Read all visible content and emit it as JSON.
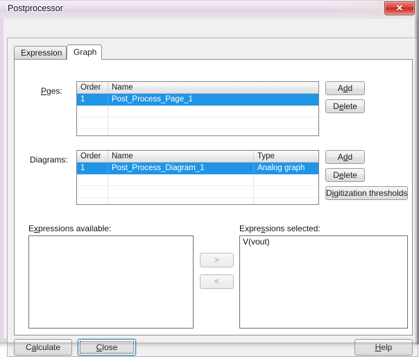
{
  "window": {
    "title": "Postprocessor",
    "close_glyph": "✕",
    "close_icon_name": "close-icon"
  },
  "tabs": [
    {
      "label": "Expression",
      "active": false
    },
    {
      "label": "Graph",
      "active": true
    }
  ],
  "pages_section": {
    "label_pre": "P",
    "label_acc": "a",
    "label_post": "ges:",
    "label_full": "Pages:",
    "columns": [
      "Order",
      "Name"
    ],
    "rows": [
      {
        "order": "1",
        "name": "Post_Process_Page_1",
        "selected": true
      },
      {
        "order": "",
        "name": "",
        "selected": false
      },
      {
        "order": "",
        "name": "",
        "selected": false
      },
      {
        "order": "",
        "name": "",
        "selected": false
      }
    ],
    "buttons": [
      {
        "pre": "A",
        "acc": "d",
        "post": "d",
        "full": "Add"
      },
      {
        "pre": "D",
        "acc": "e",
        "post": "lete",
        "full": "Delete"
      }
    ]
  },
  "diagrams_section": {
    "label_pre": "Dia",
    "label_acc": "g",
    "label_post": "rams:",
    "label_full": "Diagrams:",
    "columns": [
      "Order",
      "Name",
      "Type"
    ],
    "rows": [
      {
        "order": "1",
        "name": "Post_Process_Diagram_1",
        "type": "Analog graph",
        "selected": true
      },
      {
        "order": "",
        "name": "",
        "type": "",
        "selected": false
      },
      {
        "order": "",
        "name": "",
        "type": "",
        "selected": false
      },
      {
        "order": "",
        "name": "",
        "type": "",
        "selected": false
      }
    ],
    "buttons": [
      {
        "pre": "A",
        "acc": "d",
        "post": "d",
        "full": "Add"
      },
      {
        "pre": "D",
        "acc": "e",
        "post": "lete",
        "full": "Delete"
      },
      {
        "pre": "D",
        "acc": "i",
        "post": "gitization thresholds",
        "full": "Digitization thresholds"
      }
    ]
  },
  "expressions_available": {
    "label_pre": "E",
    "label_acc": "x",
    "label_post": "pressions available:",
    "label_full": "Expressions available:",
    "items": []
  },
  "expressions_selected": {
    "label_pre": "Expre",
    "label_acc": "s",
    "label_post": "sions selected:",
    "label_full": "Expressions selected:",
    "items": [
      "V(vout)"
    ]
  },
  "transfer_buttons": [
    {
      "label": ">",
      "name": "move-right-button",
      "disabled": true
    },
    {
      "label": "<",
      "name": "move-left-button",
      "disabled": true
    }
  ],
  "bottom_buttons": {
    "calculate": {
      "pre": "C",
      "acc": "a",
      "post": "lculate",
      "full": "Calculate"
    },
    "close": {
      "pre": "",
      "acc": "C",
      "post": "lose",
      "full": "Close"
    },
    "help": {
      "pre": "",
      "acc": "H",
      "post": "elp",
      "full": "Help"
    }
  },
  "colors": {
    "selection_blue": "#2095e6",
    "window_bg": "#f0f0f0",
    "title_glass": "#e7dbea",
    "close_red": "#c62b23",
    "default_btn_glow": "#3c7fb1"
  }
}
